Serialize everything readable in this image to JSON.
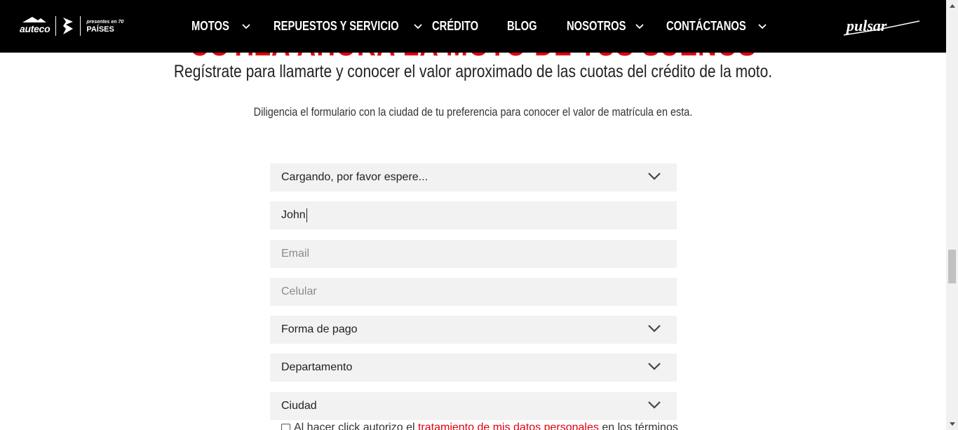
{
  "header": {
    "logo_auteco": "auteco",
    "logo_70_top": "presentes en 70",
    "logo_70_main": "PAÍSES",
    "nav": [
      {
        "label": "MOTOS",
        "dropdown": true
      },
      {
        "label": "REPUESTOS Y SERVICIO",
        "dropdown": true
      },
      {
        "label": "CRÉDITO",
        "dropdown": false
      },
      {
        "label": "BLOG",
        "dropdown": false
      },
      {
        "label": "NOSOTROS",
        "dropdown": true
      },
      {
        "label": "CONTÁCTANOS",
        "dropdown": true
      }
    ],
    "brand": "pulsar"
  },
  "hero": {
    "title": "COTIZA AHORA LA MOTO DE TUS SUEÑOS",
    "subtitle": "Regístrate para llamarte y conocer el valor aproximado de las cuotas del crédito de la moto.",
    "note": "Diligencia el formulario con la ciudad de tu preferencia para conocer el valor de matrícula en esta."
  },
  "form": {
    "model_select": "Cargando, por favor espere...",
    "name_value": "John",
    "email_placeholder": "Email",
    "phone_placeholder": "Celular",
    "payment_select": "Forma de pago",
    "department_select": "Departamento",
    "city_select": "Ciudad",
    "consent_prefix": "Al hacer click autorizo el",
    "consent_link": "tratamiento de mis datos personales",
    "consent_suffix": "en los términos"
  },
  "colors": {
    "accent": "#e1000f",
    "header_bg": "#000000",
    "field_bg": "#f2f2f2"
  }
}
